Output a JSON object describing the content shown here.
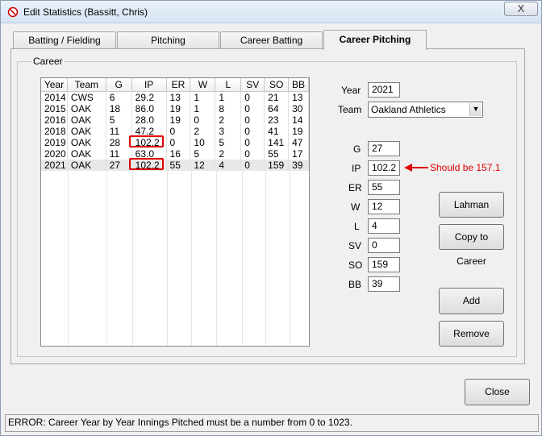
{
  "window": {
    "title": "Edit Statistics (Bassitt, Chris)",
    "close_glyph": "X"
  },
  "tabs": [
    "Batting / Fielding",
    "Pitching",
    "Career Batting",
    "Career Pitching"
  ],
  "active_tab": "Career Pitching",
  "career": {
    "group_label": "Career",
    "columns": [
      "Year",
      "Team",
      "G",
      "IP",
      "ER",
      "W",
      "L",
      "SV",
      "SO",
      "BB"
    ],
    "rows": [
      [
        "2014",
        "CWS",
        "6",
        "29.2",
        "13",
        "1",
        "1",
        "0",
        "21",
        "13"
      ],
      [
        "2015",
        "OAK",
        "18",
        "86.0",
        "19",
        "1",
        "8",
        "0",
        "64",
        "30"
      ],
      [
        "2016",
        "OAK",
        "5",
        "28.0",
        "19",
        "0",
        "2",
        "0",
        "23",
        "14"
      ],
      [
        "2018",
        "OAK",
        "11",
        "47.2",
        "0",
        "2",
        "3",
        "0",
        "41",
        "19"
      ],
      [
        "2019",
        "OAK",
        "28",
        "102.2",
        "0",
        "10",
        "5",
        "0",
        "141",
        "47"
      ],
      [
        "2020",
        "OAK",
        "11",
        "63.0",
        "16",
        "5",
        "2",
        "0",
        "55",
        "17"
      ],
      [
        "2021",
        "OAK",
        "27",
        "102.2",
        "55",
        "12",
        "4",
        "0",
        "159",
        "39"
      ]
    ],
    "selected_row": 6
  },
  "form": {
    "year_label": "Year",
    "year_value": "2021",
    "team_label": "Team",
    "team_value": "Oakland Athletics",
    "g_label": "G",
    "g_value": "27",
    "ip_label": "IP",
    "ip_value": "102.2",
    "er_label": "ER",
    "er_value": "55",
    "w_label": "W",
    "w_value": "12",
    "l_label": "L",
    "l_value": "4",
    "sv_label": "SV",
    "sv_value": "0",
    "so_label": "SO",
    "so_value": "159",
    "bb_label": "BB",
    "bb_value": "39"
  },
  "buttons": {
    "lahman": "Lahman",
    "copy_to_career": "Copy to Career",
    "add": "Add",
    "remove": "Remove",
    "close": "Close"
  },
  "annotation": {
    "text": "Should be 157.1",
    "color": "#e00000"
  },
  "status": {
    "message": "ERROR:  Career Year by Year Innings Pitched must be a number from 0 to 1023."
  }
}
